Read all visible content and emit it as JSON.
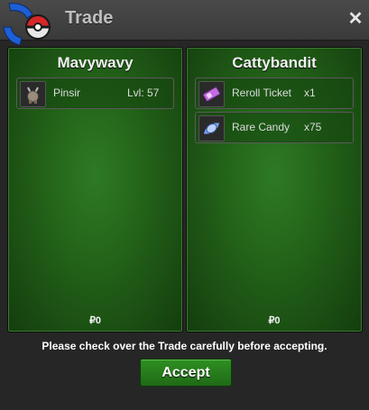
{
  "window": {
    "title": "Trade",
    "close_label": "✕"
  },
  "trade": {
    "left": {
      "player": "Mavywavy",
      "items": [
        {
          "name": "Pinsir",
          "extra": "Lvl: 57",
          "icon": "pinsir-sprite-icon"
        }
      ],
      "money": "₽0"
    },
    "right": {
      "player": "Cattybandit",
      "items": [
        {
          "name": "Reroll Ticket",
          "extra": "x1",
          "icon": "ticket-icon"
        },
        {
          "name": "Rare Candy",
          "extra": "x75",
          "icon": "candy-icon"
        }
      ],
      "money": "₽0"
    }
  },
  "footer": {
    "notice": "Please check over the Trade carefully before accepting.",
    "accept_label": "Accept"
  },
  "colors": {
    "panel_green": "#226018",
    "accent": "#2f8f22"
  }
}
